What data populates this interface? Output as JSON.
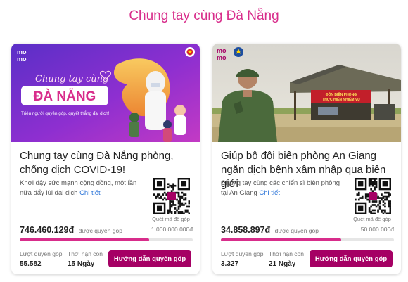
{
  "page": {
    "title": "Chung tay cùng Đà Nẵng"
  },
  "brand": {
    "momo_line1": "mo",
    "momo_line2": "mo",
    "accent": "#d82d8b",
    "button_color": "#a50064"
  },
  "cards": [
    {
      "banner": {
        "script_text": "Chung tay cùng",
        "headline": "ĐÀ NẴNG",
        "tagline": "Triệu người quyên góp, quyết thắng đại dịch!"
      },
      "title": "Chung tay cùng Đà Nẵng phòng, chống dịch COVID-19!",
      "description": "Khơi dậy sức mạnh cộng đồng, một lần nữa đẩy lùi đại dịch",
      "detail_link": "Chi tiết",
      "qr_caption": "Quét mã để góp",
      "raised": "746.460.129đ",
      "raised_label": "được quyên góp",
      "goal": "1.000.000.000đ",
      "progress_fraction": 0.746,
      "donors_label": "Lượt quyên góp",
      "donors": "55.582",
      "days_label": "Thời hạn còn",
      "days": "15 Ngày",
      "button": "Hướng dẫn quyên góp"
    },
    {
      "banner": {
        "sign_line1": "ĐỒN BIÊN PHÒNG",
        "sign_line2": "THỰC HIỆN NHIỆM VỤ"
      },
      "title": "Giúp bộ đội biên phòng An Giang ngăn dịch bệnh xâm nhập qua biên giới",
      "description": "Chung tay cùng các chiến sĩ biên phòng tại An Giang",
      "detail_link": "Chi tiết",
      "qr_caption": "Quét mã để góp",
      "raised": "34.858.897đ",
      "raised_label": "được quyên góp",
      "goal": "50.000.000đ",
      "progress_fraction": 0.697,
      "donors_label": "Lượt quyên góp",
      "donors": "3.327",
      "days_label": "Thời hạn còn",
      "days": "21 Ngày",
      "button": "Hướng dẫn quyên góp"
    }
  ]
}
